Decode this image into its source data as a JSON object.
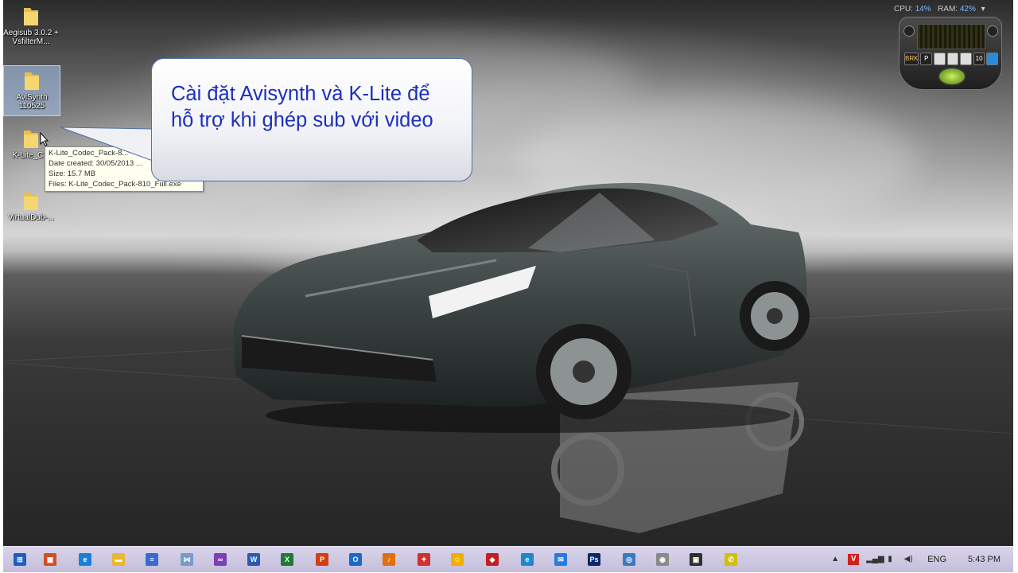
{
  "desktop_icons": [
    {
      "label": "Aegisub 3.0.2 + VsfilterM..."
    },
    {
      "label": "AviSynth 110525"
    },
    {
      "label": "K-Lite_C..."
    },
    {
      "label": "VirtualDub-..."
    }
  ],
  "tooltip": {
    "name": "K-Lite_Codec_Pack-8...",
    "date": "Date created: 30/05/2013 ...",
    "size": "Size: 15.7 MB",
    "files": "Files: K-Lite_Codec_Pack-810_Full.exe"
  },
  "callout": {
    "text": "Cài đặt Avisynth và K-Lite để hỗ trợ khi ghép sub với video"
  },
  "gadget": {
    "cpu_label": "CPU:",
    "cpu_value": "14%",
    "ram_label": "RAM:",
    "ram_value": "42%",
    "buttons": [
      "BRK",
      "P",
      "",
      "",
      "",
      "10",
      ""
    ]
  },
  "taskbar": {
    "apps": [
      {
        "name": "start-button",
        "glyph": "⊞",
        "color": "#1e5fbf"
      },
      {
        "name": "calculator-icon",
        "glyph": "▦",
        "color": "#d05020"
      },
      {
        "name": "internet-explorer-icon",
        "glyph": "e",
        "color": "#1a7fd8"
      },
      {
        "name": "file-explorer-icon",
        "glyph": "▬",
        "color": "#e8b830"
      },
      {
        "name": "stack-app-icon",
        "glyph": "≡",
        "color": "#3a6ad0"
      },
      {
        "name": "network-app-icon",
        "glyph": "⋈",
        "color": "#7a9ac8"
      },
      {
        "name": "visual-studio-icon",
        "glyph": "∞",
        "color": "#7a40b8"
      },
      {
        "name": "word-icon",
        "glyph": "W",
        "color": "#2b5ab0"
      },
      {
        "name": "excel-icon",
        "glyph": "X",
        "color": "#1f7a3a"
      },
      {
        "name": "powerpoint-icon",
        "glyph": "P",
        "color": "#d04010"
      },
      {
        "name": "outlook-icon",
        "glyph": "O",
        "color": "#1b6ac8"
      },
      {
        "name": "media-player-icon",
        "glyph": "♪",
        "color": "#e07010"
      },
      {
        "name": "tool-icon",
        "glyph": "✦",
        "color": "#d03030"
      },
      {
        "name": "emoji-messenger-icon",
        "glyph": "☺",
        "color": "#f0b000"
      },
      {
        "name": "shield-icon",
        "glyph": "◆",
        "color": "#c02020"
      },
      {
        "name": "browser-icon",
        "glyph": "e",
        "color": "#1a8ad0"
      },
      {
        "name": "cloud-app-icon",
        "glyph": "✉",
        "color": "#2a7ae0"
      },
      {
        "name": "photoshop-icon",
        "glyph": "Ps",
        "color": "#0a2a6a"
      },
      {
        "name": "globe-icon",
        "glyph": "◎",
        "color": "#3a7ac0"
      },
      {
        "name": "camera-app-icon",
        "glyph": "◉",
        "color": "#8a8a8a"
      },
      {
        "name": "paint-app-icon",
        "glyph": "▣",
        "color": "#303030"
      },
      {
        "name": "phone-app-icon",
        "glyph": "✆",
        "color": "#d0c000"
      }
    ],
    "language": "ENG",
    "clock": "5:43 PM"
  }
}
